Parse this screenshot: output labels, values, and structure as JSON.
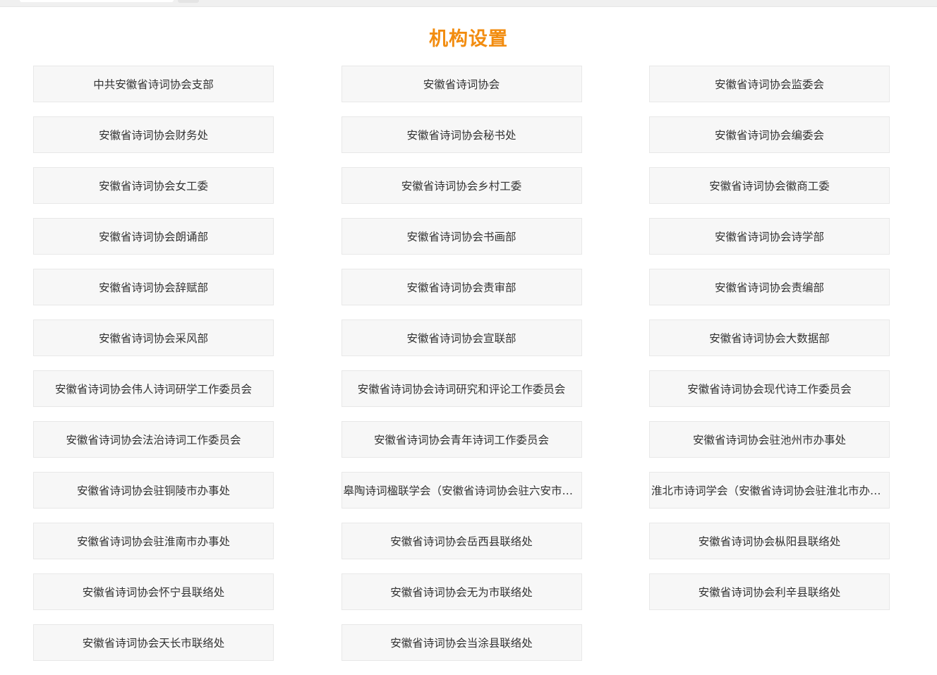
{
  "page_title": "机构设置",
  "colors": {
    "title": "#f28c0f",
    "item_bg": "#f7f7f7",
    "item_border": "#e8e8e8",
    "item_text": "#333333"
  },
  "organizations": [
    "中共安徽省诗词协会支部",
    "安徽省诗词协会",
    "安徽省诗词协会监委会",
    "安徽省诗词协会财务处",
    "安徽省诗词协会秘书处",
    "安徽省诗词协会编委会",
    "安徽省诗词协会女工委",
    "安徽省诗词协会乡村工委",
    "安徽省诗词协会徽商工委",
    "安徽省诗词协会朗诵部",
    "安徽省诗词协会书画部",
    "安徽省诗词协会诗学部",
    "安徽省诗词协会辞赋部",
    "安徽省诗词协会责审部",
    "安徽省诗词协会责编部",
    "安徽省诗词协会采风部",
    "安徽省诗词协会宣联部",
    "安徽省诗词协会大数据部",
    "安徽省诗词协会伟人诗词研学工作委员会",
    "安徽省诗词协会诗词研究和评论工作委员会",
    "安徽省诗词协会现代诗工作委员会",
    "安徽省诗词协会法治诗词工作委员会",
    "安徽省诗词协会青年诗词工作委员会",
    "安徽省诗词协会驻池州市办事处",
    "安徽省诗词协会驻铜陵市办事处",
    "皋陶诗词楹联学会（安徽省诗词协会驻六安市办事处）",
    "淮北市诗词学会（安徽省诗词协会驻淮北市办事处）",
    "安徽省诗词协会驻淮南市办事处",
    "安徽省诗词协会岳西县联络处",
    "安徽省诗词协会枞阳县联络处",
    "安徽省诗词协会怀宁县联络处",
    "安徽省诗词协会无为市联络处",
    "安徽省诗词协会利辛县联络处",
    "安徽省诗词协会天长市联络处",
    "安徽省诗词协会当涂县联络处"
  ]
}
